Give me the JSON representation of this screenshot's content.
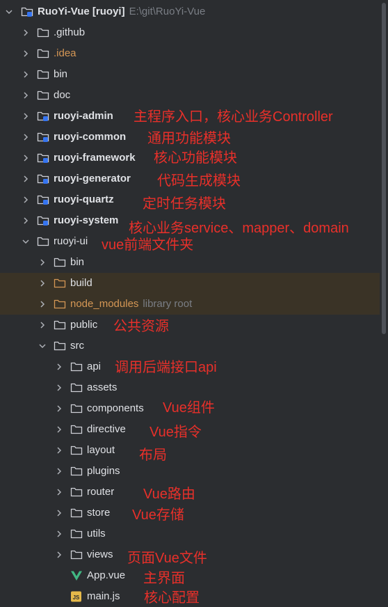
{
  "project": {
    "name": "RuoYi-Vue",
    "module": "[ruoyi]",
    "path": "E:\\git\\RuoYi-Vue"
  },
  "tree": [
    {
      "label": ".github"
    },
    {
      "label": ".idea"
    },
    {
      "label": "bin"
    },
    {
      "label": "doc"
    },
    {
      "label": "ruoyi-admin"
    },
    {
      "label": "ruoyi-common"
    },
    {
      "label": "ruoyi-framework"
    },
    {
      "label": "ruoyi-generator"
    },
    {
      "label": "ruoyi-quartz"
    },
    {
      "label": "ruoyi-system"
    },
    {
      "label": "ruoyi-ui"
    },
    {
      "label": "bin"
    },
    {
      "label": "build"
    },
    {
      "label": "node_modules",
      "extra": "library root"
    },
    {
      "label": "public"
    },
    {
      "label": "src"
    },
    {
      "label": "api"
    },
    {
      "label": "assets"
    },
    {
      "label": "components"
    },
    {
      "label": "directive"
    },
    {
      "label": "layout"
    },
    {
      "label": "plugins"
    },
    {
      "label": "router"
    },
    {
      "label": "store"
    },
    {
      "label": "utils"
    },
    {
      "label": "views"
    },
    {
      "label": "App.vue"
    },
    {
      "label": "main.js"
    }
  ],
  "annotations": {
    "admin": "主程序入口，核心业务Controller",
    "common": "通用功能模块",
    "framework": "核心功能模块",
    "generator": "代码生成模块",
    "quartz": "定时任务模块",
    "system": "核心业务service、mapper、domain",
    "ui": "vue前端文件夹",
    "public": "公共资源",
    "api": "调用后端接口api",
    "components": "Vue组件",
    "directive": "Vue指令",
    "layout": "布局",
    "router": "Vue路由",
    "store": "Vue存储",
    "views": "页面Vue文件",
    "app": "主界面",
    "main": "核心配置"
  },
  "colors": {
    "background": "#2b2d30",
    "text": "#dfe1e5",
    "excluded": "#d59755",
    "annotation": "#e8302a",
    "highlight": "#3a3326"
  }
}
